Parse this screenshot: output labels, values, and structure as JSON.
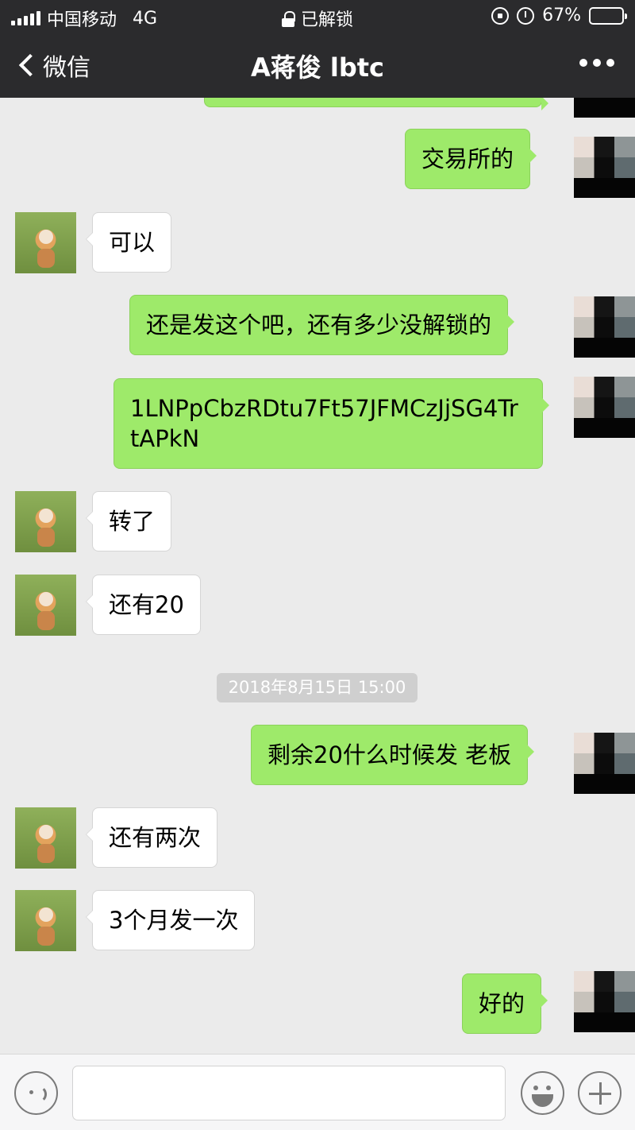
{
  "status_bar": {
    "carrier": "中国移动",
    "network": "4G",
    "lock_text": "已解锁",
    "battery_percent": "67%",
    "battery_level": 0.67,
    "battery_color": "#f7c600"
  },
  "nav": {
    "back_label": "微信",
    "title": "A蒋俊 lbtc"
  },
  "messages": [
    {
      "side": "out",
      "text": "交易所的"
    },
    {
      "side": "in",
      "text": "可以"
    },
    {
      "side": "out",
      "text": "还是发这个吧，还有多少没解锁的"
    },
    {
      "side": "out",
      "text": "1LNPpCbzRDtu7Ft57JFMCzJjSG4TrtAPkN"
    },
    {
      "side": "in",
      "text": "转了"
    },
    {
      "side": "in",
      "text": "还有20"
    },
    {
      "side": "out",
      "text": "剩余20什么时候发 老板"
    },
    {
      "side": "in",
      "text": "还有两次"
    },
    {
      "side": "in",
      "text": "3个月发一次"
    },
    {
      "side": "out",
      "text": "好的"
    }
  ],
  "timestamp": "2018年8月15日 15:00",
  "input": {
    "value": ""
  },
  "colors": {
    "header_bg": "#2b2b2d",
    "chat_bg": "#ebebeb",
    "outgoing_bubble": "#9eea6a",
    "incoming_bubble": "#ffffff"
  }
}
